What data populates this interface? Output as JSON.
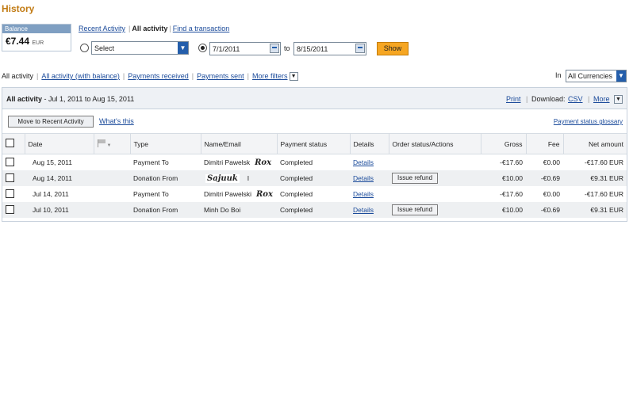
{
  "page": {
    "title": "History"
  },
  "balance": {
    "label": "Balance",
    "amount": "€7.44",
    "currency": "EUR"
  },
  "top_tabs": {
    "recent": "Recent Activity",
    "all": "All activity",
    "find": "Find a transaction"
  },
  "range": {
    "select_value": "Select",
    "from": "7/1/2011",
    "to_label": "to",
    "to": "8/15/2011",
    "show_label": "Show"
  },
  "filters": {
    "all": "All activity",
    "all_balance": "All activity (with balance)",
    "received": "Payments received",
    "sent": "Payments sent",
    "more": "More filters"
  },
  "currency": {
    "in_label": "In",
    "value": "All Currencies"
  },
  "panel": {
    "title_bold": "All activity",
    "title_range": " - Jul 1, 2011 to Aug 15, 2011",
    "print": "Print",
    "download_label": "Download:",
    "csv": "CSV",
    "more": "More",
    "move_button": "Move to Recent Activity",
    "whats_this": "What's this",
    "glossary": "Payment status glossary"
  },
  "table": {
    "headers": {
      "date": "Date",
      "type": "Type",
      "name": "Name/Email",
      "status": "Payment status",
      "details": "Details",
      "order": "Order status/Actions",
      "gross": "Gross",
      "fee": "Fee",
      "net": "Net amount"
    },
    "rows": [
      {
        "date": "Aug 15, 2011",
        "type": "Payment To",
        "name": "Dimitri Pawelsk",
        "sig": "Rox",
        "status": "Completed",
        "details": "Details",
        "action": "",
        "gross": "-€17.60",
        "fee": "€0.00",
        "net": "-€17.60 EUR"
      },
      {
        "date": "Aug 14, 2011",
        "type": "Donation From",
        "name": "Sajuuk",
        "sig": "I",
        "status": "Completed",
        "details": "Details",
        "action": "Issue refund",
        "gross": "€10.00",
        "fee": "-€0.69",
        "net": "€9.31 EUR"
      },
      {
        "date": "Jul 14, 2011",
        "type": "Payment To",
        "name": "Dimitri Pawelski",
        "sig": "Rox",
        "status": "Completed",
        "details": "Details",
        "action": "",
        "gross": "-€17.60",
        "fee": "€0.00",
        "net": "-€17.60 EUR"
      },
      {
        "date": "Jul 10, 2011",
        "type": "Donation From",
        "name": "Minh Do Boi",
        "sig": "",
        "status": "Completed",
        "details": "Details",
        "action": "Issue refund",
        "gross": "€10.00",
        "fee": "-€0.69",
        "net": "€9.31 EUR"
      }
    ]
  }
}
